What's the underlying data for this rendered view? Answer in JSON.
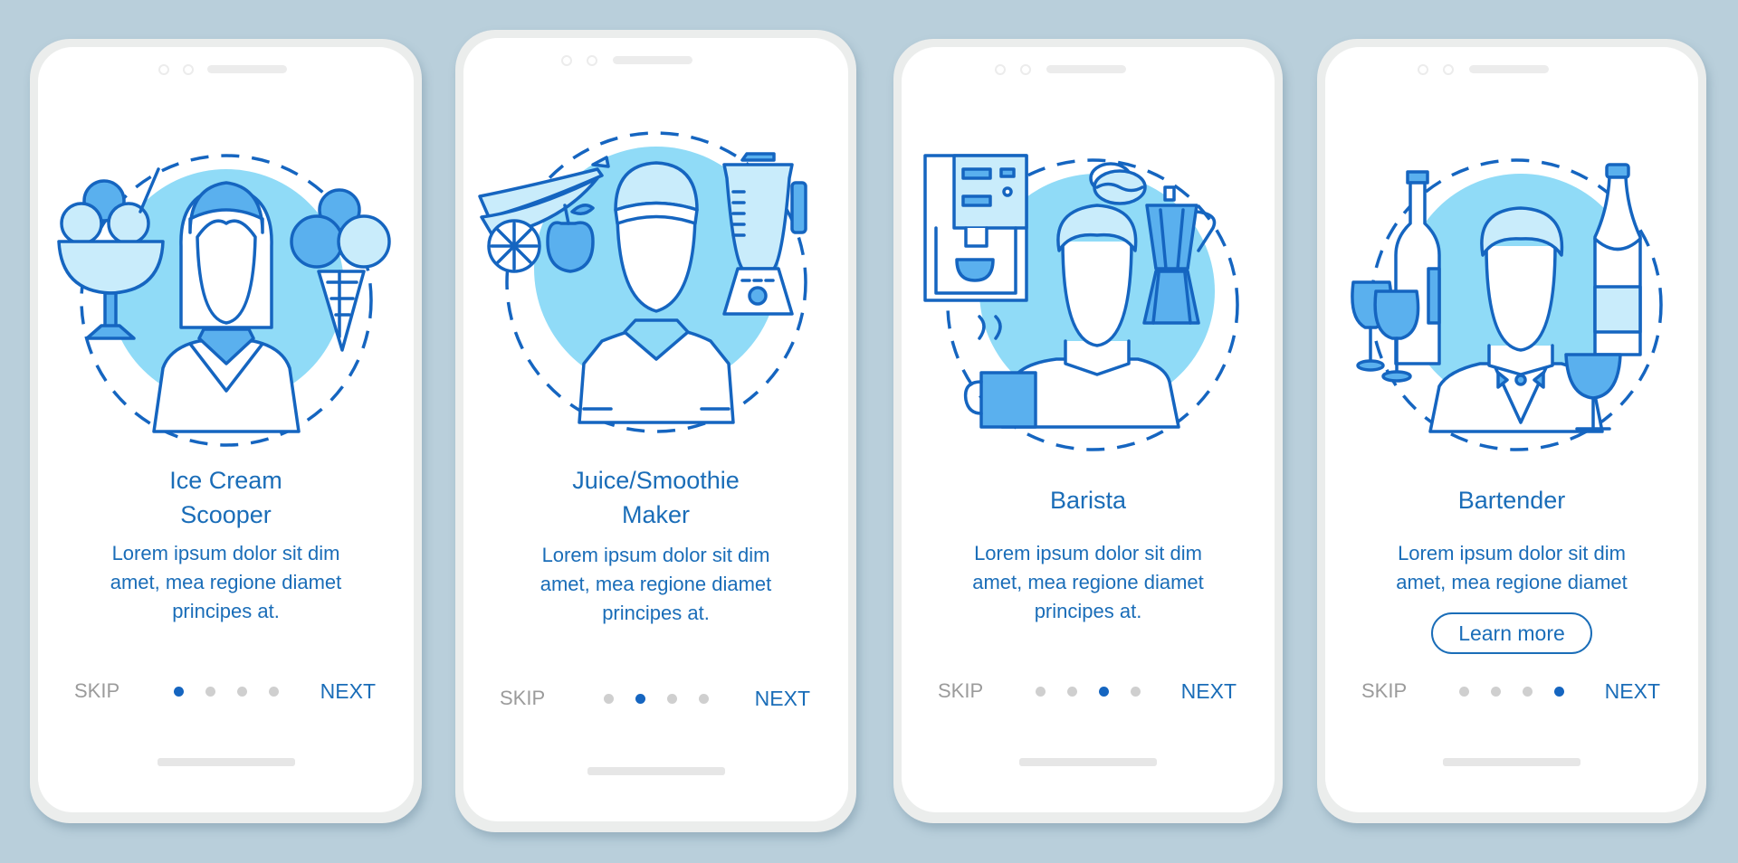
{
  "colors": {
    "background": "#b9cfdb",
    "accent": "#1a6db8",
    "stroke": "#1565c0",
    "circle_fill": "#90dbf7",
    "mid_fill": "#5ab0ee",
    "light_fill": "#c9ecfb",
    "muted": "#9b9b9b",
    "dot_inactive": "#cfcfcf"
  },
  "screens": [
    {
      "illustration": "ice-cream-scooper-illustration",
      "title_lines": [
        "Ice Cream",
        "Scooper"
      ],
      "description_lines": [
        "Lorem ipsum dolor sit dim",
        "amet, mea regione diamet",
        "principes at."
      ],
      "skip_label": "SKIP",
      "next_label": "NEXT",
      "page_index": 1,
      "page_count": 4
    },
    {
      "illustration": "juice-smoothie-maker-illustration",
      "title_lines": [
        "Juice/Smoothie",
        "Maker"
      ],
      "description_lines": [
        "Lorem ipsum dolor sit dim",
        "amet, mea regione diamet",
        "principes at."
      ],
      "skip_label": "SKIP",
      "next_label": "NEXT",
      "page_index": 2,
      "page_count": 4
    },
    {
      "illustration": "barista-illustration",
      "title_lines": [
        "Barista"
      ],
      "description_lines": [
        "Lorem ipsum dolor sit dim",
        "amet, mea regione diamet",
        "principes at."
      ],
      "skip_label": "SKIP",
      "next_label": "NEXT",
      "page_index": 3,
      "page_count": 4
    },
    {
      "illustration": "bartender-illustration",
      "title_lines": [
        "Bartender"
      ],
      "description_lines": [
        "Lorem ipsum dolor sit dim",
        "amet, mea regione diamet"
      ],
      "button_label": "Learn more",
      "skip_label": "SKIP",
      "next_label": "NEXT",
      "page_index": 4,
      "page_count": 4
    }
  ]
}
